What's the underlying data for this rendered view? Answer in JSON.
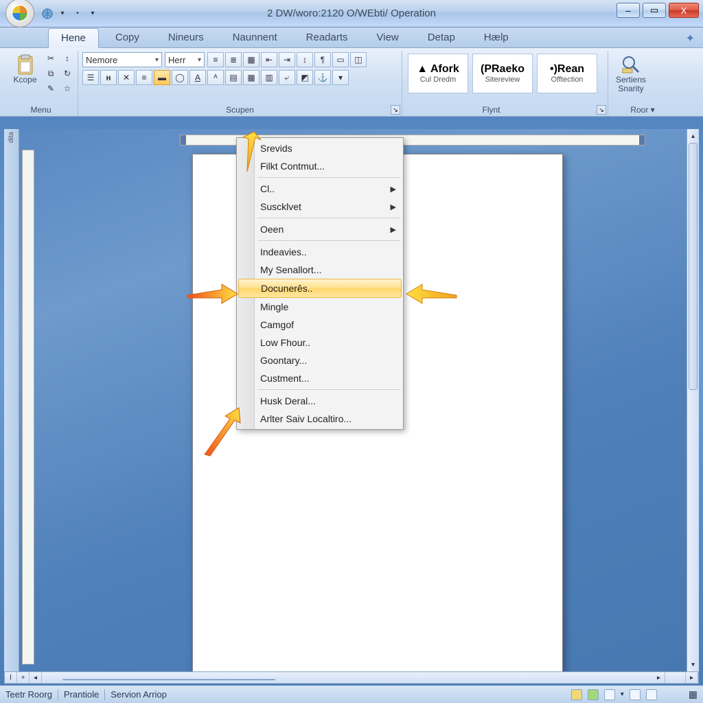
{
  "titlebar": {
    "title": "2 DW/woro:2120 O/WEbti/ Operation"
  },
  "win": {
    "min": "–",
    "max": "▭",
    "close": "X"
  },
  "tabs": {
    "items": [
      {
        "label": "Hene",
        "active": true
      },
      {
        "label": "Copy"
      },
      {
        "label": "Nineurs"
      },
      {
        "label": "Naunnent"
      },
      {
        "label": "Readarts"
      },
      {
        "label": "View"
      },
      {
        "label": "Detap"
      },
      {
        "label": "Hælp"
      }
    ]
  },
  "ribbon": {
    "group_menu": {
      "label": "Menu",
      "big_label": "Kcope"
    },
    "group_scupen": {
      "label": "Scupen",
      "font_name": "Nemore",
      "font_size": "Herr"
    },
    "group_flynt": {
      "label": "Flynt"
    },
    "group_styles": {
      "cards": [
        {
          "top": "▲ Afork",
          "bot": "Cul Dredm"
        },
        {
          "top": "(PRaeko",
          "bot": "Sitereview"
        },
        {
          "top": "•)Rean",
          "bot": "Offtection"
        }
      ]
    },
    "group_roor": {
      "label": "Roor ▾",
      "big_label1": "Sertiens",
      "big_label2": "Snarity"
    }
  },
  "context_menu": {
    "items": [
      {
        "label": "Srevids",
        "type": "item"
      },
      {
        "label": "Filkt Contmut...",
        "type": "item"
      },
      {
        "type": "sep"
      },
      {
        "label": "Cl..",
        "type": "submenu"
      },
      {
        "label": "Suscklvet",
        "type": "submenu"
      },
      {
        "type": "sep"
      },
      {
        "label": "Oeen",
        "type": "submenu"
      },
      {
        "type": "sep"
      },
      {
        "label": "Indeavies..",
        "type": "item"
      },
      {
        "label": "My Senallort...",
        "type": "item"
      },
      {
        "label": "Docunerês..",
        "type": "item",
        "highlight": true
      },
      {
        "label": "Mingle",
        "type": "item"
      },
      {
        "label": "Camgof",
        "type": "item"
      },
      {
        "label": "Low Fhour..",
        "type": "item"
      },
      {
        "label": "Goontary...",
        "type": "item"
      },
      {
        "label": "Custment...",
        "type": "item"
      },
      {
        "type": "sep"
      },
      {
        "label": "Husk Deral...",
        "type": "item"
      },
      {
        "label": "Arlter Saiv Localtiro...",
        "type": "item"
      }
    ]
  },
  "statusbar": {
    "left": [
      "Teetr Roorg",
      "Prantiole",
      "Servion Arriop"
    ]
  }
}
